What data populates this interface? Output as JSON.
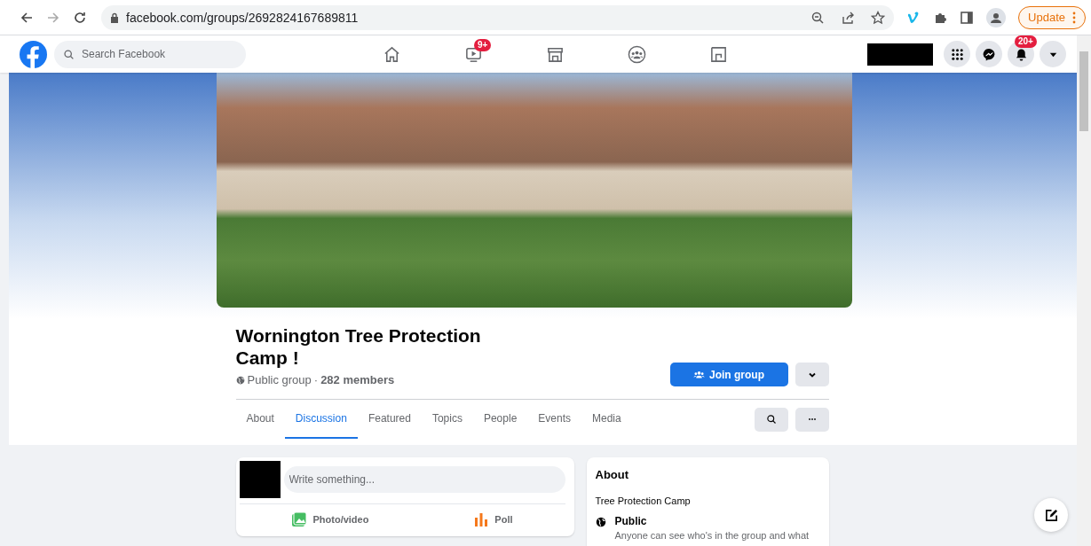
{
  "browser": {
    "url": "facebook.com/groups/2692824167689811",
    "update_label": "Update"
  },
  "header": {
    "search_placeholder": "Search Facebook",
    "nav": [
      {
        "kind": "home"
      },
      {
        "kind": "video",
        "badge": "9+"
      },
      {
        "kind": "store"
      },
      {
        "kind": "groups"
      },
      {
        "kind": "gaming"
      }
    ],
    "actions": [
      {
        "kind": "menu"
      },
      {
        "kind": "messenger"
      },
      {
        "kind": "bell",
        "badge": "20+"
      },
      {
        "kind": "caret"
      }
    ]
  },
  "group": {
    "name": "Wornington Tree Protection Camp !",
    "privacy": "Public group",
    "separator": "·",
    "members": "282 members",
    "join_label": "Join group"
  },
  "tabs": [
    {
      "label": "About",
      "selected": false
    },
    {
      "label": "Discussion",
      "selected": true
    },
    {
      "label": "Featured",
      "selected": false
    },
    {
      "label": "Topics",
      "selected": false
    },
    {
      "label": "People",
      "selected": false
    },
    {
      "label": "Events",
      "selected": false
    },
    {
      "label": "Media",
      "selected": false
    }
  ],
  "composer": {
    "placeholder": "Write something...",
    "actions": [
      {
        "kind": "photo",
        "label": "Photo/video"
      },
      {
        "kind": "poll",
        "label": "Poll"
      }
    ]
  },
  "about": {
    "title": "About",
    "description": "Tree Protection Camp",
    "privacy_title": "Public",
    "privacy_text": "Anyone can see who's in the group and what"
  }
}
